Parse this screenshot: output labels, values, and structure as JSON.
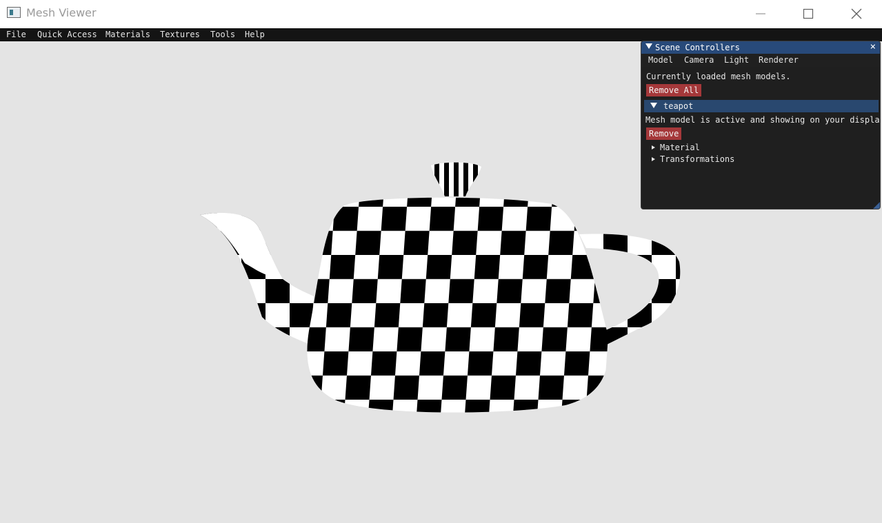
{
  "window": {
    "title": "Mesh Viewer"
  },
  "menu": [
    "File",
    "Quick Access",
    "Materials",
    "Textures",
    "Tools",
    "Help"
  ],
  "panel": {
    "title": "Scene Controllers",
    "tabs": [
      "Model",
      "Camera",
      "Light",
      "Renderer"
    ],
    "loaded_text": "Currently loaded mesh models.",
    "remove_all_label": "Remove All",
    "model": {
      "name": "teapot",
      "status_text": "Mesh model is active and showing on your display",
      "remove_label": "Remove",
      "sections": [
        "Material",
        "Transformations"
      ]
    }
  },
  "colors": {
    "panel_bg": "#1f1f1f",
    "title_bg": "#284a7a",
    "tree_header_bg": "#29486f",
    "button_red": "#a5383a",
    "viewport_bg": "#e4e4e4"
  },
  "icons": [
    "app-icon",
    "minimize-icon",
    "maximize-icon",
    "close-icon",
    "collapse-arrow-icon",
    "panel-close-icon"
  ]
}
